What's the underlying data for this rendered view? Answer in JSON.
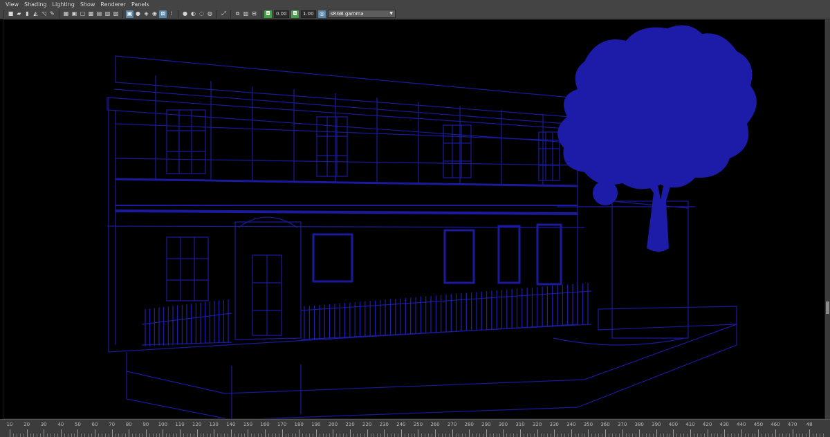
{
  "menu": [
    "View",
    "Shading",
    "Lighting",
    "Show",
    "Renderer",
    "Panels"
  ],
  "toolbar": {
    "icons_group1": [
      "camera-icon",
      "camera-attributes-icon",
      "bookmark-icon",
      "image-plane-icon",
      "2d-pan-zoom-icon",
      "grease-pencil-icon"
    ],
    "icons_group2": [
      "grid-icon",
      "film-gate-icon",
      "resolution-gate-icon",
      "gate-mask-icon",
      "field-chart-icon",
      "safe-action-icon",
      "safe-title-icon"
    ],
    "icons_group3": [
      "wireframe-icon",
      "smooth-shade-icon",
      "bounding-box-icon",
      "textured-icon",
      "xray-icon",
      "lights-icon"
    ],
    "icons_group4": [
      "shadows-icon",
      "ambient-occlusion-icon",
      "motion-blur-icon",
      "anti-aliasing-icon"
    ],
    "icons_group5": [
      "isolate-select-icon",
      "xray-joints-icon",
      "xray-active-icon",
      "backface-culling-icon"
    ],
    "exposure_value": "0.00",
    "gamma_value": "1.00",
    "color_space": "sRGB gamma"
  },
  "timeline": {
    "ticks": [
      "10",
      "20",
      "30",
      "40",
      "50",
      "60",
      "70",
      "80",
      "90",
      "100",
      "110",
      "120",
      "130",
      "140",
      "150",
      "160",
      "170",
      "180",
      "190",
      "200",
      "210",
      "220",
      "230",
      "240",
      "250",
      "260",
      "270",
      "280",
      "290",
      "300",
      "310",
      "320",
      "330",
      "340",
      "350",
      "360",
      "370",
      "380",
      "390",
      "400",
      "410",
      "420",
      "430",
      "440",
      "450",
      "460",
      "470",
      "48"
    ]
  },
  "colors": {
    "wireframe": "#1a1a9e",
    "wireframe_bright": "#2323c8",
    "tree_fill": "#1c1ca8",
    "ui_bg": "#444444",
    "viewport_bg": "#000000"
  }
}
